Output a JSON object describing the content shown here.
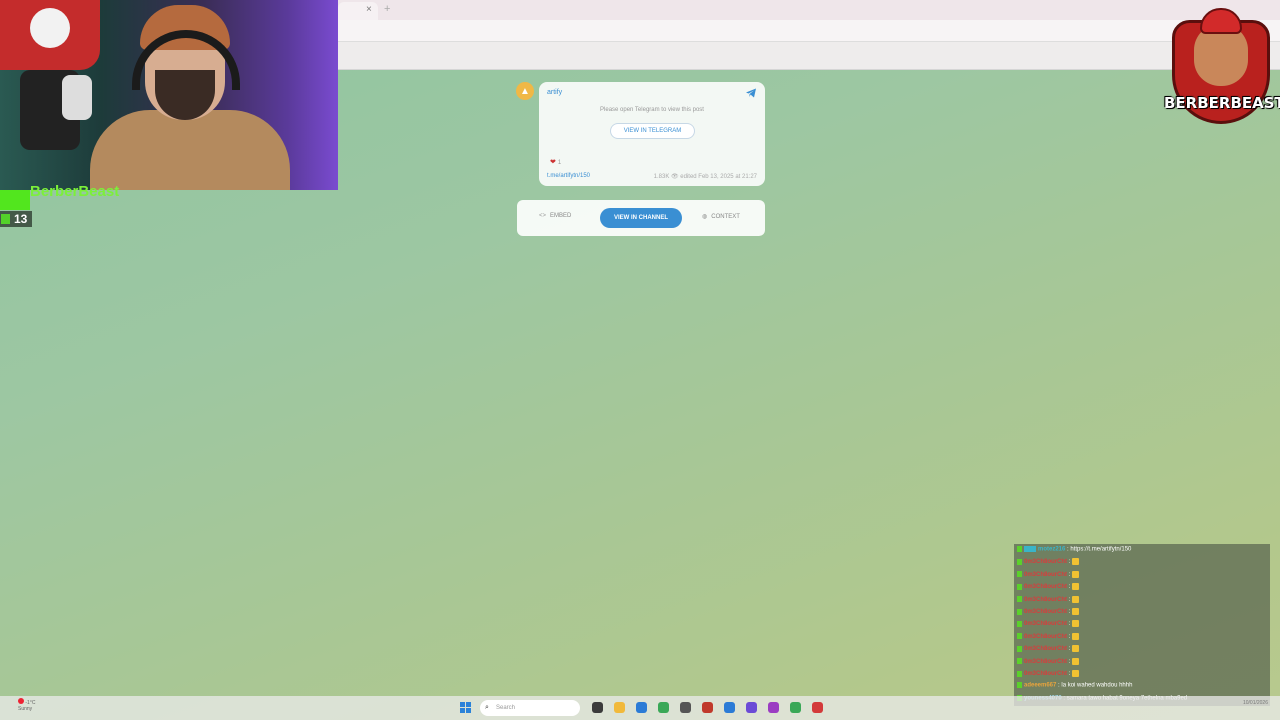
{
  "browser": {
    "tab_close": "×",
    "tab_new": "+"
  },
  "streamer": {
    "name": "BerberBeast",
    "viewer_count": "13"
  },
  "logo": {
    "text": "BERBERBEAST"
  },
  "post": {
    "channel_name": "artify",
    "notice": "Please open Telegram to view this post",
    "view_telegram_label": "VIEW IN TELEGRAM",
    "reaction_emoji": "❤",
    "reaction_count": "1",
    "link": "t.me/artifytn/150",
    "meta": "1.83K 👁 edited Feb 13, 2025 at 21:27"
  },
  "actions": {
    "embed_label": "EMBED",
    "view_channel_label": "VIEW IN CHANNEL",
    "context_label": "CONTEXT"
  },
  "chat": {
    "messages": [
      {
        "user": "motez216",
        "user_color": "#3ab4c8",
        "text": ": https://t.me/artifytn/150",
        "emoji": false
      },
      {
        "user": "0m3Ch8ourCht",
        "user_color": "#d83c3c",
        "text": ":",
        "emoji": true
      },
      {
        "user": "0m3Ch8ourCht",
        "user_color": "#d83c3c",
        "text": ":",
        "emoji": true
      },
      {
        "user": "0m3Ch8ourCht",
        "user_color": "#d83c3c",
        "text": ":",
        "emoji": true
      },
      {
        "user": "0m3Ch8ourCht",
        "user_color": "#d83c3c",
        "text": ":",
        "emoji": true
      },
      {
        "user": "0m3Ch8ourCht",
        "user_color": "#d83c3c",
        "text": ":",
        "emoji": true
      },
      {
        "user": "0m3Ch8ourCht",
        "user_color": "#d83c3c",
        "text": ":",
        "emoji": true
      },
      {
        "user": "0m3Ch8ourCht",
        "user_color": "#d83c3c",
        "text": ":",
        "emoji": true
      },
      {
        "user": "0m3Ch8ourCht",
        "user_color": "#d83c3c",
        "text": ":",
        "emoji": true
      },
      {
        "user": "0m3Ch8ourCht",
        "user_color": "#d83c3c",
        "text": ":",
        "emoji": true
      },
      {
        "user": "0m3Ch8ourCht",
        "user_color": "#d83c3c",
        "text": ":",
        "emoji": true
      },
      {
        "user": "adeeem667",
        "user_color": "#e8a33c",
        "text": ": la koi wahed wahdou hhhh",
        "emoji": false
      },
      {
        "user": "youness4070",
        "user_color": "#9fd0e0",
        "text": ": samara tawo habat 9oneya 7ethelna mba9ed",
        "emoji": false
      }
    ]
  },
  "taskbar": {
    "weather": "-1°C",
    "weather_sub": "Sunny",
    "search_placeholder": "Search",
    "time": "10/01/2026",
    "icon_colors": [
      "#3b3b3b",
      "#f1b93a",
      "#2b7bd6",
      "#3aa857",
      "#555555",
      "#c0392b",
      "#2b7bd6",
      "#6b4bd6",
      "#9b3dc2",
      "#3aa857",
      "#d33a3a"
    ]
  }
}
